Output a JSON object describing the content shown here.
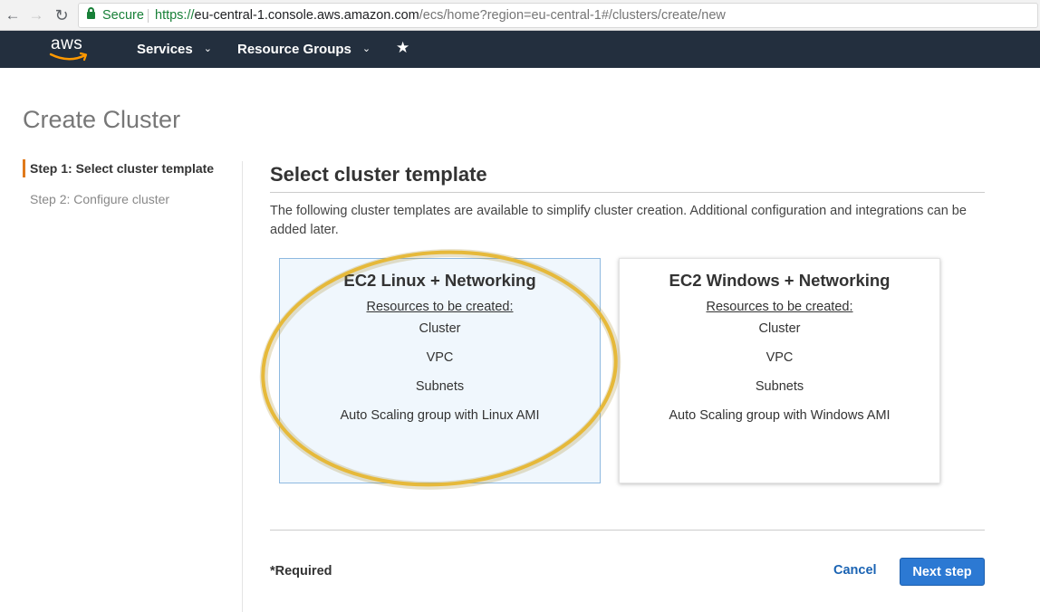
{
  "browser": {
    "nav": {
      "back": "←",
      "forward": "→",
      "reload": "↻"
    },
    "secure_label": "Secure",
    "url_scheme": "https://",
    "url_host": "eu-central-1.console.aws.amazon.com",
    "url_path": "/ecs/home?region=eu-central-1#/clusters/create/new"
  },
  "aws_nav": {
    "logo_text": "aws",
    "menus": [
      {
        "label": "Services",
        "chevron": "⌄"
      },
      {
        "label": "Resource Groups",
        "chevron": "⌄"
      }
    ],
    "pin": "★"
  },
  "page": {
    "title": "Create Cluster"
  },
  "steps": [
    {
      "label": "Step 1: Select cluster template",
      "active": true
    },
    {
      "label": "Step 2: Configure cluster",
      "active": false
    }
  ],
  "section": {
    "title": "Select cluster template",
    "description": "The following cluster templates are available to simplify cluster creation. Additional configuration and integrations can be added later."
  },
  "cards": [
    {
      "title": "EC2 Linux + Networking",
      "resources_label": "Resources to be created:",
      "items": [
        "Cluster",
        "VPC",
        "Subnets",
        "Auto Scaling group with Linux AMI"
      ]
    },
    {
      "title": "EC2 Windows + Networking",
      "resources_label": "Resources to be created:",
      "items": [
        "Cluster",
        "VPC",
        "Subnets",
        "Auto Scaling group with Windows AMI"
      ]
    }
  ],
  "footer": {
    "required_label": "*Required",
    "cancel_label": "Cancel",
    "next_label": "Next step"
  },
  "colors": {
    "nav_bg": "#232f3e",
    "step_accent": "#e07a1b",
    "primary_button": "#2c79d3",
    "link": "#1a63b3",
    "highlight_ring": "#e6b93a"
  }
}
